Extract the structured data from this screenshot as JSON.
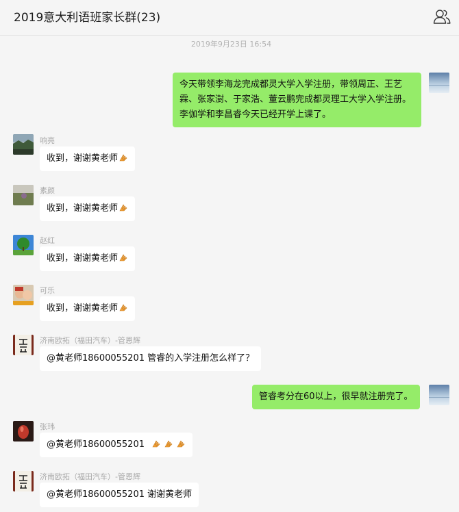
{
  "header": {
    "title": "2019意大利语班家长群(23)",
    "members_icon": "group-members-icon"
  },
  "chat": {
    "timestamp": "2019年9月23日 16:54",
    "messages": [
      {
        "from": "self",
        "avatar": "sky-photo-avatar",
        "lines": [
          "今天带领李海龙完成都灵大学入学注册，带领周正、王艺",
          "霖、张家澍、于家浩、董云鹏完成都灵理工大学入学注册。",
          "李伽学和李昌睿今天已经开学上课了。"
        ]
      },
      {
        "from": "other",
        "sender": "响亮",
        "avatar": "landscape-photo-avatar",
        "text": "收到，谢谢黄老师",
        "emoji": "hands-together-emoji"
      },
      {
        "from": "other",
        "sender": "素颜",
        "avatar": "field-photo-avatar",
        "text": "收到，谢谢黄老师",
        "emoji": "hands-together-emoji"
      },
      {
        "from": "other",
        "sender": "赵红",
        "avatar": "tree-photo-avatar",
        "text": "收到，谢谢黄老师",
        "emoji": "hands-together-emoji"
      },
      {
        "from": "other",
        "sender": "可乐",
        "avatar": "couple-photo-avatar",
        "text": "收到，谢谢黄老师",
        "emoji": "hands-together-emoji"
      },
      {
        "from": "other",
        "sender": "济南欧拓（福田汽车）-管恩辉",
        "avatar": "calligraphy-avatar",
        "text": "@黄老师18600055201 管睿的入学注册怎么样了？"
      },
      {
        "from": "self",
        "avatar": "sky-photo-avatar",
        "text": "管睿考分在60以上，很早就注册完了。"
      },
      {
        "from": "other",
        "sender": "张玮",
        "avatar": "red-object-avatar",
        "text": "@黄老师18600055201",
        "emoji_count": 3,
        "emoji": "hands-together-emoji"
      },
      {
        "from": "other",
        "sender": "济南欧拓（福田汽车）-管恩辉",
        "avatar": "calligraphy-avatar",
        "text": "@黄老师18600055201 谢谢黄老师"
      }
    ]
  },
  "colors": {
    "outgoing_bubble": "#95ec69",
    "incoming_bubble": "#ffffff",
    "background": "#f5f5f5"
  }
}
